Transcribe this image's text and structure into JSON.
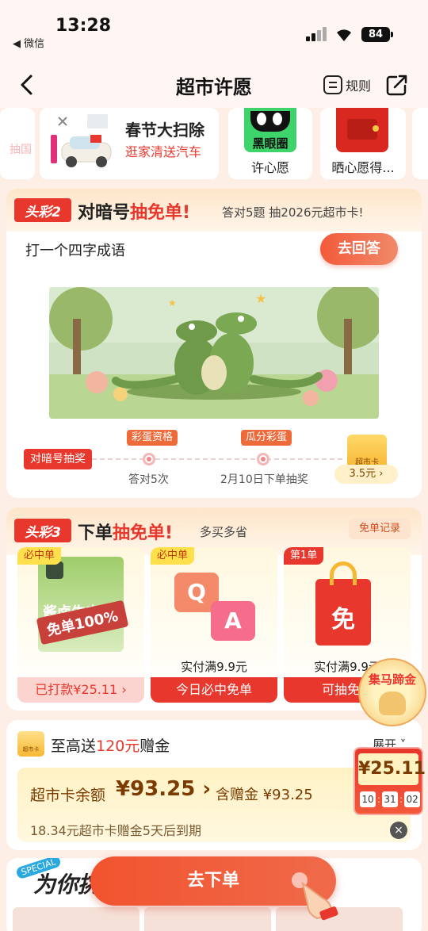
{
  "status": {
    "time": "13:28",
    "back_app": "◀ 微信",
    "battery": "84"
  },
  "nav": {
    "title": "超市许愿",
    "rules": "规则"
  },
  "wishes": {
    "partial_left": "抽国",
    "main_title": "春节大扫除",
    "main_sub": "逛家清送汽车",
    "card2_label": "许心愿",
    "card2_logo_text": "黑眼圈",
    "card3_label": "晒心愿得..."
  },
  "sec2": {
    "badge": "头彩2",
    "title_a": "对暗号",
    "title_b": "抽免单",
    "title_c": "!",
    "sub": "答对5题 抽2026元超市卡!",
    "question": "打一个四字成语",
    "answer_btn": "去回答",
    "progress": {
      "start": "对暗号抽奖",
      "tag1": "彩蛋资格",
      "label1": "答对5次",
      "tag2": "瓜分彩蛋",
      "label2": "2月10日下单抽奖",
      "card_text": "超市卡",
      "card_price": "3.5元 ›"
    }
  },
  "sec3": {
    "badge": "头彩3",
    "title_a": "下单",
    "title_b": "抽免单",
    "title_c": "!",
    "sub": "多买多省",
    "record": "免单记录",
    "products": [
      {
        "tag": "必中单",
        "cond": "",
        "btn": "已打款¥25.11 ›",
        "overlay": "免单100%",
        "pack_text": "酱卤牛肉"
      },
      {
        "tag": "必中单",
        "cond": "实付满9.9元",
        "btn": "今日必中免单"
      },
      {
        "tag": "第1单",
        "cond": "实付满9.9元",
        "btn": "可抽免单",
        "bag_text": "免"
      }
    ]
  },
  "sec4": {
    "icon_text": "超市卡",
    "title_a": "至高送",
    "title_b": "120元",
    "title_c": "赠金",
    "expand": "展开 ˅",
    "balance_label": "超市卡余额",
    "balance": "¥93.25 ›",
    "bonus": "含赠金 ¥93.25",
    "expire": "18.34元超市卡赠金5天后到期",
    "close": "×"
  },
  "float": {
    "horse_text": "集马蹄金",
    "timer_amount": "¥25.11",
    "timer": [
      "10",
      "31",
      "02"
    ]
  },
  "sec5": {
    "special": "SPECIAL",
    "title": "为你挑"
  },
  "order_btn": "去下单",
  "colors": {
    "accent": "#e8372c",
    "gold": "#f7b733",
    "bg": "#fdeee6"
  }
}
